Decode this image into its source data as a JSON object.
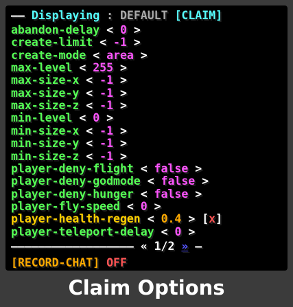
{
  "header": {
    "left_rule": "——",
    "label": "Displaying",
    "colon": ":",
    "mode": "DEFAULT",
    "selected_open": "[",
    "selected": "CLAIM",
    "selected_close": "]"
  },
  "arrows": {
    "left": "<",
    "right": ">"
  },
  "options": [
    {
      "key": "abandon-delay",
      "value": "0"
    },
    {
      "key": "create-limit",
      "value": "-1"
    },
    {
      "key": "create-mode",
      "value": "area"
    },
    {
      "key": "max-level",
      "value": "255"
    },
    {
      "key": "max-size-x",
      "value": "-1"
    },
    {
      "key": "max-size-y",
      "value": "-1"
    },
    {
      "key": "max-size-z",
      "value": "-1"
    },
    {
      "key": "min-level",
      "value": "0"
    },
    {
      "key": "min-size-x",
      "value": "-1"
    },
    {
      "key": "min-size-y",
      "value": "-1"
    },
    {
      "key": "min-size-z",
      "value": "-1"
    },
    {
      "key": "player-deny-flight",
      "value": "false"
    },
    {
      "key": "player-deny-godmode",
      "value": "false"
    },
    {
      "key": "player-deny-hunger",
      "value": "false"
    },
    {
      "key": "player-fly-speed",
      "value": "0"
    },
    {
      "key": "player-health-regen",
      "value": "0.4"
    },
    {
      "key": "player-teleport-delay",
      "value": "0"
    }
  ],
  "delete_button": {
    "open": "[",
    "label": "x",
    "close": "]"
  },
  "pagination": {
    "rule": "——————————————————",
    "prev": "«",
    "page": "1/2",
    "next": "»",
    "tail": "—"
  },
  "record_chat": {
    "open": "[",
    "label": "RECORD-CHAT",
    "close": "]",
    "state": "OFF"
  },
  "caption": "Claim Options",
  "colors": {
    "option_key": "#55ff55",
    "option_key_active": "#ffd000",
    "option_value": "#ff55ff",
    "option_value_active": "#ffaa00",
    "header_accent": "#55ffff",
    "off": "#ff5555",
    "link": "#5555ff"
  }
}
